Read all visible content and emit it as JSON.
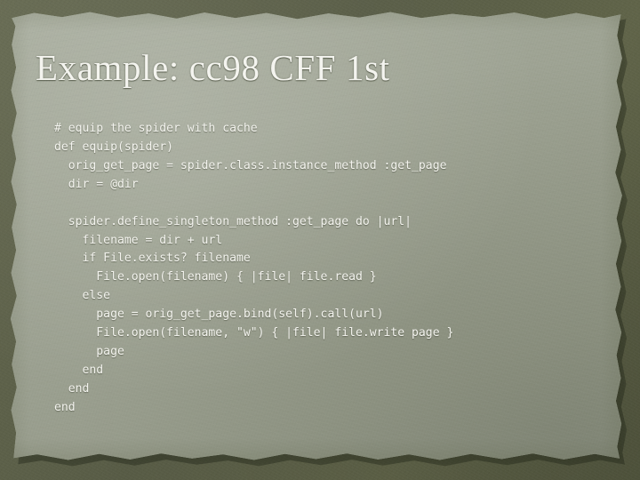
{
  "slide": {
    "title": "Example: cc98 CFF 1st",
    "colors": {
      "border": "#5c6049",
      "paper": "#9fa495",
      "text": "#f3f3ee",
      "title_text": "#f4f4ef"
    }
  },
  "code": {
    "language": "ruby",
    "lines": [
      "# equip the spider with cache",
      "def equip(spider)",
      "  orig_get_page = spider.class.instance_method :get_page",
      "  dir = @dir",
      "",
      "  spider.define_singleton_method :get_page do |url|",
      "    filename = dir + url",
      "    if File.exists? filename",
      "      File.open(filename) { |file| file.read }",
      "    else",
      "      page = orig_get_page.bind(self).call(url)",
      "      File.open(filename, \"w\") { |file| file.write page }",
      "      page",
      "    end",
      "  end",
      "end"
    ]
  }
}
